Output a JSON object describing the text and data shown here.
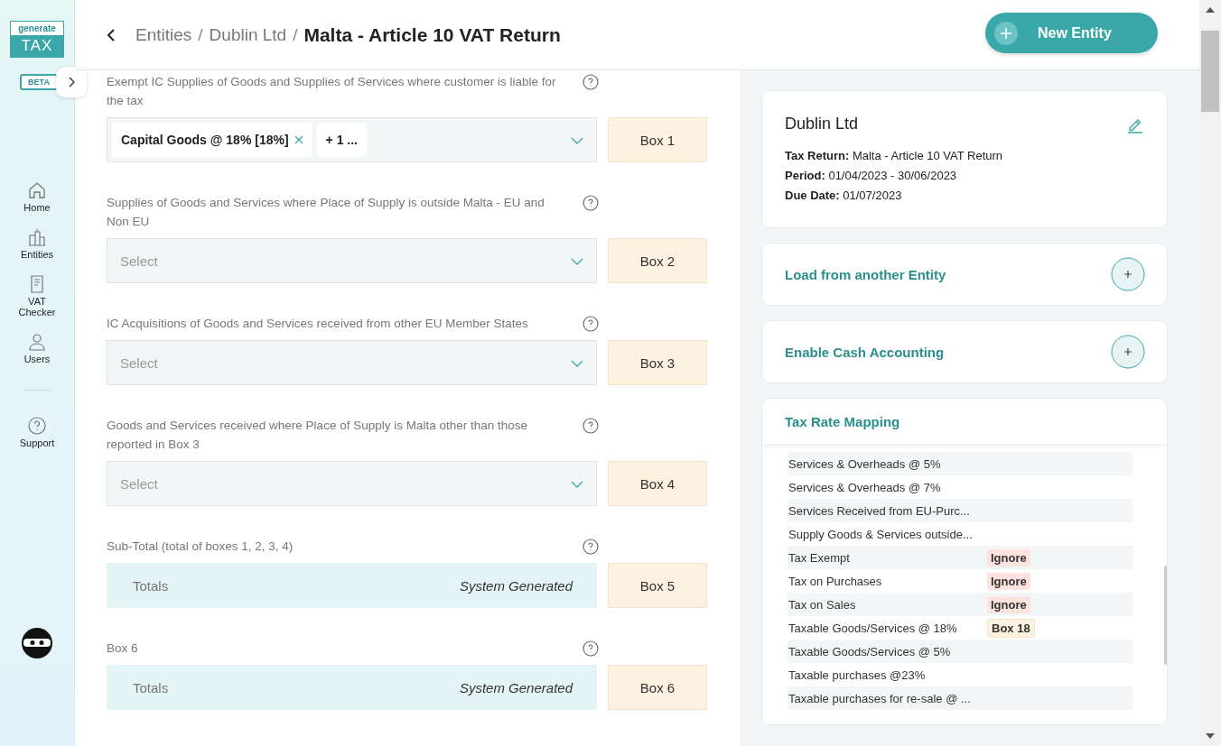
{
  "logo": {
    "top": "generate",
    "bottom": "TAX"
  },
  "beta": "BETA",
  "nav": [
    {
      "label": "Home"
    },
    {
      "label": "Entities"
    },
    {
      "label": "VAT Checker"
    },
    {
      "label": "Users"
    }
  ],
  "nav_footer": [
    {
      "label": "Support"
    }
  ],
  "breadcrumb": {
    "items": [
      {
        "kind": "link",
        "text": "Entities"
      },
      {
        "kind": "sep",
        "text": "/"
      },
      {
        "kind": "link",
        "text": "Dublin Ltd"
      },
      {
        "kind": "sep",
        "text": "/"
      }
    ],
    "current": "Malta - Article 10 VAT Return"
  },
  "new_button": "New Entity",
  "fields": [
    {
      "kind": "select",
      "label": "Exempt IC Supplies of Goods and Supplies of Services where customer is liable for the tax",
      "tags": [
        "Capital Goods @ 18% [18%]"
      ],
      "more": "+ 1 ...",
      "box": "Box 1"
    },
    {
      "kind": "select",
      "label": "Supplies of Goods and Services where Place of Supply is outside Malta - EU and Non EU",
      "placeholder": "Select",
      "box": "Box 2"
    },
    {
      "kind": "select",
      "label": "IC Acquisitions of Goods and Services received from other EU Member States",
      "placeholder": "Select",
      "box": "Box 3"
    },
    {
      "kind": "select",
      "label": "Goods and Services received where Place of Supply is Malta other than those reported in Box 3",
      "placeholder": "Select",
      "box": "Box 4"
    },
    {
      "kind": "totals",
      "label": "Sub-Total (total of boxes 1, 2, 3, 4)",
      "name": "Totals",
      "value": "System Generated",
      "box": "Box 5"
    },
    {
      "kind": "totals",
      "label": "Box 6",
      "name": "Totals",
      "value": "System Generated",
      "box": "Box 6"
    }
  ],
  "entity": {
    "name": "Dublin Ltd",
    "details": [
      {
        "label": "Tax Return:",
        "value": "Malta - Article 10 VAT Return"
      },
      {
        "label": "Period:",
        "value": "01/04/2023 - 30/06/2023"
      },
      {
        "label": "Due Date:",
        "value": "01/07/2023"
      }
    ]
  },
  "actions": [
    "Load from another Entity",
    "Enable Cash Accounting"
  ],
  "mapping": {
    "title": "Tax Rate Mapping",
    "rows": [
      {
        "name": "Services & Overheads @ 5%"
      },
      {
        "name": "Services & Overheads @ 7%"
      },
      {
        "name": "Services Received from EU-Purc..."
      },
      {
        "name": "Supply Goods & Services outside..."
      },
      {
        "name": "Tax Exempt",
        "badge": {
          "text": "Ignore",
          "kind": "ignore"
        }
      },
      {
        "name": "Tax on Purchases",
        "badge": {
          "text": "Ignore",
          "kind": "ignore"
        }
      },
      {
        "name": "Tax on Sales",
        "badge": {
          "text": "Ignore",
          "kind": "ignore"
        }
      },
      {
        "name": "Taxable Goods/Services @ 18%",
        "badge": {
          "text": "Box 18",
          "kind": "box"
        }
      },
      {
        "name": "Taxable Goods/Services @ 5%"
      },
      {
        "name": "Taxable purchases @23%"
      },
      {
        "name": "Taxable purchases for re-sale @ ..."
      }
    ]
  }
}
